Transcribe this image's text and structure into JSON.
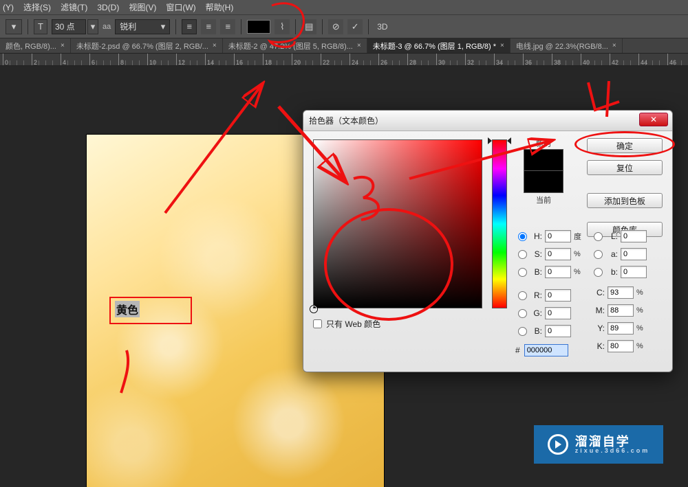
{
  "menu": [
    "(Y)",
    "选择(S)",
    "滤镜(T)",
    "3D(D)",
    "视图(V)",
    "窗口(W)",
    "帮助(H)"
  ],
  "options": {
    "fontUnitGlyph": "T",
    "fontSize": "30 点",
    "aaLabel": "aa",
    "aaMode": "锐利",
    "threeD": "3D"
  },
  "tabs": [
    {
      "label": "颜色, RGB/8)...",
      "active": false
    },
    {
      "label": "未标题-2.psd @ 66.7% (图层 2, RGB/...",
      "active": false
    },
    {
      "label": "未标题-2 @ 47.2% (图层 5, RGB/8)...",
      "active": false
    },
    {
      "label": "未标题-3 @ 66.7% (图层 1, RGB/8) *",
      "active": true
    },
    {
      "label": "电线.jpg @ 22.3%(RGB/8...",
      "active": false
    }
  ],
  "rulerTicks": [
    0,
    2,
    4,
    6,
    8,
    10,
    12,
    14,
    16,
    18,
    20,
    22,
    24,
    26,
    28,
    30,
    32,
    34,
    36,
    38,
    40,
    42,
    44,
    46
  ],
  "canvasText": "黄色",
  "dialog": {
    "title": "拾色器（文本颜色）",
    "close": "✕",
    "ok": "确定",
    "reset": "复位",
    "addSwatch": "添加到色板",
    "colorLib": "颜色库",
    "newLabel": "新的",
    "currentLabel": "当前",
    "webOnly": "只有 Web 颜色",
    "radios": {
      "H": {
        "label": "H:",
        "val": "0",
        "unit": "度"
      },
      "S": {
        "label": "S:",
        "val": "0",
        "unit": "%"
      },
      "Bv": {
        "label": "B:",
        "val": "0",
        "unit": "%"
      },
      "R": {
        "label": "R:",
        "val": "0"
      },
      "G": {
        "label": "G:",
        "val": "0"
      },
      "Bc": {
        "label": "B:",
        "val": "0"
      },
      "L": {
        "label": "L:",
        "val": "0"
      },
      "a": {
        "label": "a:",
        "val": "0"
      },
      "b": {
        "label": "b:",
        "val": "0"
      }
    },
    "cmyk": {
      "C": {
        "label": "C:",
        "val": "93",
        "unit": "%"
      },
      "M": {
        "label": "M:",
        "val": "88",
        "unit": "%"
      },
      "Y": {
        "label": "Y:",
        "val": "89",
        "unit": "%"
      },
      "K": {
        "label": "K:",
        "val": "80",
        "unit": "%"
      }
    },
    "hexPrefix": "#",
    "hex": "000000"
  },
  "watermark": {
    "big": "溜溜自学",
    "small": "zixue.3d66.com"
  },
  "chart_data": null
}
